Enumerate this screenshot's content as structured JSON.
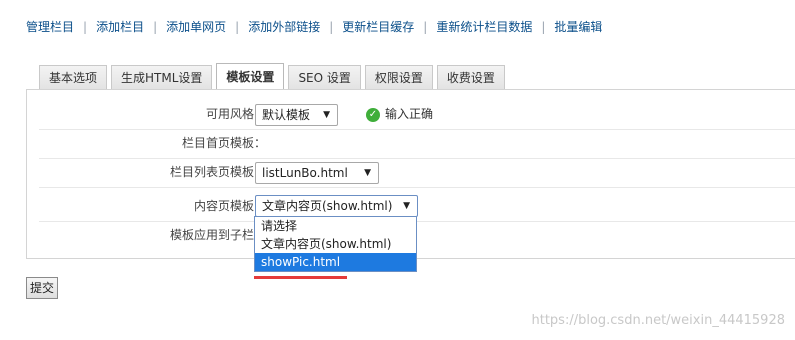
{
  "nav": {
    "links": [
      "管理栏目",
      "添加栏目",
      "添加单网页",
      "添加外部链接",
      "更新栏目缓存",
      "重新统计栏目数据",
      "批量编辑"
    ]
  },
  "tabs": [
    "基本选项",
    "生成HTML设置",
    "模板设置",
    "SEO 设置",
    "权限设置",
    "收费设置"
  ],
  "active_tab": "模板设置",
  "form": {
    "style_label": "可用风格：",
    "style_value": "默认模板",
    "style_ok": "输入正确",
    "index_tpl_label": "栏目首页模板：",
    "list_tpl_label": "栏目列表页模板：",
    "list_tpl_value": "listLunBo.html",
    "content_tpl_label": "内容页模板：",
    "content_tpl_value": "文章内容页(show.html)",
    "apply_label": "模板应用到子栏目"
  },
  "dropdown": {
    "options": [
      "请选择",
      "文章内容页(show.html)",
      "showPic.html"
    ],
    "highlighted": "showPic.html"
  },
  "submit_label": "提交",
  "watermark": "https://blog.csdn.net/weixin_44415928",
  "colors": {
    "link": "#0b4f8a",
    "selected_option": "#1e7ae0",
    "ok_icon": "#3fae3a",
    "annotation": "#e43a3a"
  },
  "icons": [
    "check-circle-icon",
    "dropdown-arrow-icon"
  ]
}
